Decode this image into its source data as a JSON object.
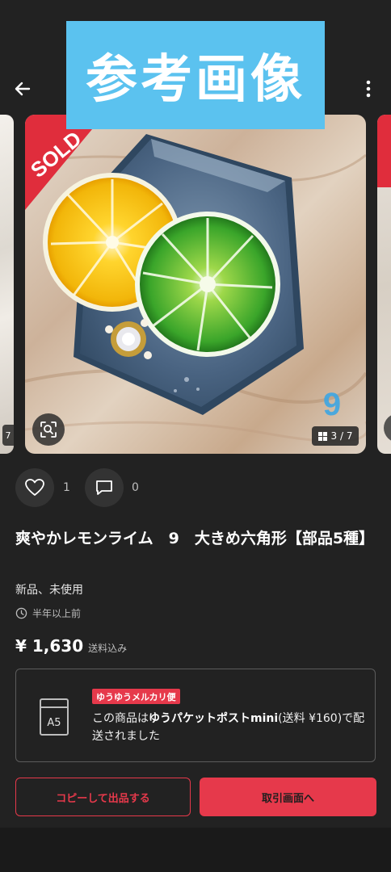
{
  "reference_banner": {
    "label": "参考画像"
  },
  "gallery": {
    "sold_label": "SOLD",
    "number_mark": "9",
    "counter": "3 / 7",
    "left_counter": "7",
    "colors": {
      "sold_red": "#e02d3c",
      "number_blue": "#3da6e3"
    }
  },
  "actions": {
    "like_count": "1",
    "comment_count": "0"
  },
  "item": {
    "title": "爽やかレモンライム　9　大きめ六角形【部品5種】",
    "condition": "新品、未使用",
    "posted": "半年以上前",
    "price": "¥ 1,630",
    "price_note": "送料込み"
  },
  "shipping": {
    "size_icon_label": "A5",
    "badge": "ゆうゆうメルカリ便",
    "text_before": "この商品は",
    "text_bold": "ゆうパケットポストmini",
    "text_after": "(送料 ¥160)で配送されました"
  },
  "buttons": {
    "copy_listing": "コピーして出品する",
    "trade_screen": "取引画面へ"
  },
  "theme": {
    "accent": "#e6394b",
    "background": "#222222",
    "banner": "#5bc2ef"
  }
}
